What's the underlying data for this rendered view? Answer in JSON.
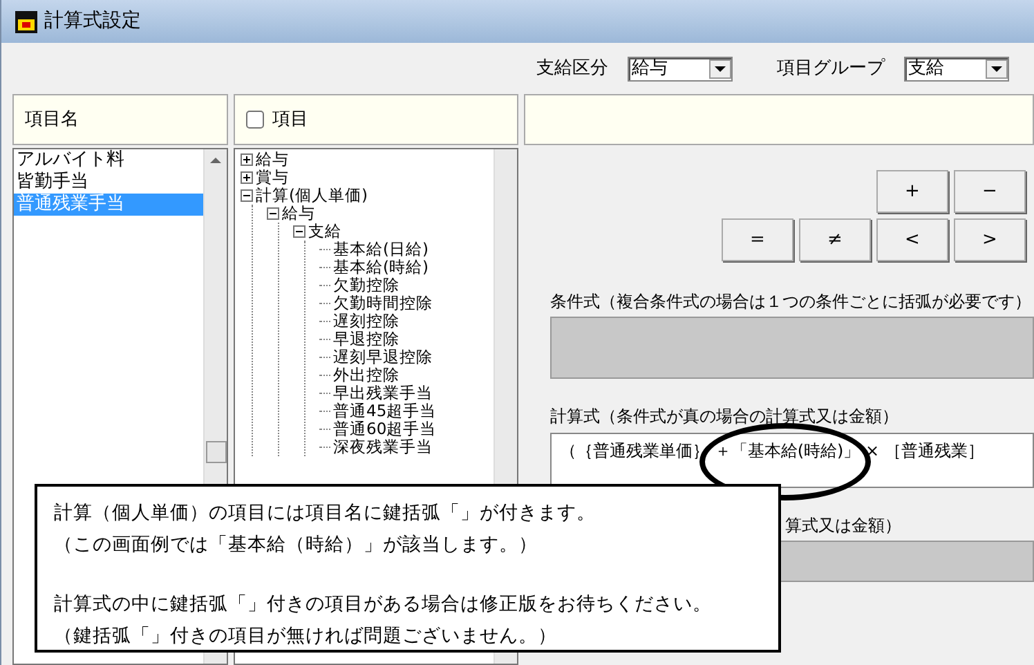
{
  "window": {
    "title": "計算式設定"
  },
  "toolbar": {
    "fields": [
      {
        "label": "支給区分",
        "value": "給与"
      },
      {
        "label": "項目グループ",
        "value": "支給"
      }
    ]
  },
  "item_list": {
    "header": "項目名",
    "items": [
      {
        "label": "アルバイト料",
        "selected": false
      },
      {
        "label": "皆勤手当",
        "selected": false
      },
      {
        "label": "普通残業手当",
        "selected": true
      }
    ]
  },
  "tree": {
    "header": {
      "label": "項目",
      "checked": false
    },
    "nodes": [
      {
        "label": "給与",
        "expanded": false
      },
      {
        "label": "賞与",
        "expanded": false
      },
      {
        "label": "計算(個人単価)",
        "expanded": true,
        "children": [
          {
            "label": "給与",
            "expanded": true,
            "children": [
              {
                "label": "支給",
                "expanded": true,
                "children": [
                  {
                    "label": "基本給(日給)"
                  },
                  {
                    "label": "基本給(時給)"
                  },
                  {
                    "label": "欠勤控除"
                  },
                  {
                    "label": "欠勤時間控除"
                  },
                  {
                    "label": "遅刻控除"
                  },
                  {
                    "label": "早退控除"
                  },
                  {
                    "label": "遅刻早退控除"
                  },
                  {
                    "label": "外出控除"
                  },
                  {
                    "label": "早出残業手当"
                  },
                  {
                    "label": "普通45超手当"
                  },
                  {
                    "label": "普通60超手当"
                  },
                  {
                    "label": "深夜残業手当"
                  }
                ]
              }
            ]
          }
        ]
      }
    ]
  },
  "operator_buttons": [
    [
      "+",
      "−"
    ],
    [
      "=",
      "≠",
      "<",
      ">"
    ]
  ],
  "condition": {
    "label": "条件式（複合条件式の場合は１つの条件ごとに括弧が必要です）"
  },
  "formula": {
    "label": "計算式（条件式が真の場合の計算式又は金額）",
    "value": "（｛普通残業単価｝ ＋「基本給(時給)」 × ［普通残業］"
  },
  "else_formula": {
    "label": "算式又は金額）"
  },
  "callout": {
    "paragraphs": [
      [
        "計算（個人単価）の項目には項目名に鍵括弧「」が付きます。",
        "（この画面例では「基本給（時給）」が該当します。）"
      ],
      [
        "計算式の中に鍵括弧「」付きの項目がある場合は修正版をお待ちください。",
        "（鍵括弧「」付きの項目が無ければ問題ございません。）"
      ]
    ]
  }
}
